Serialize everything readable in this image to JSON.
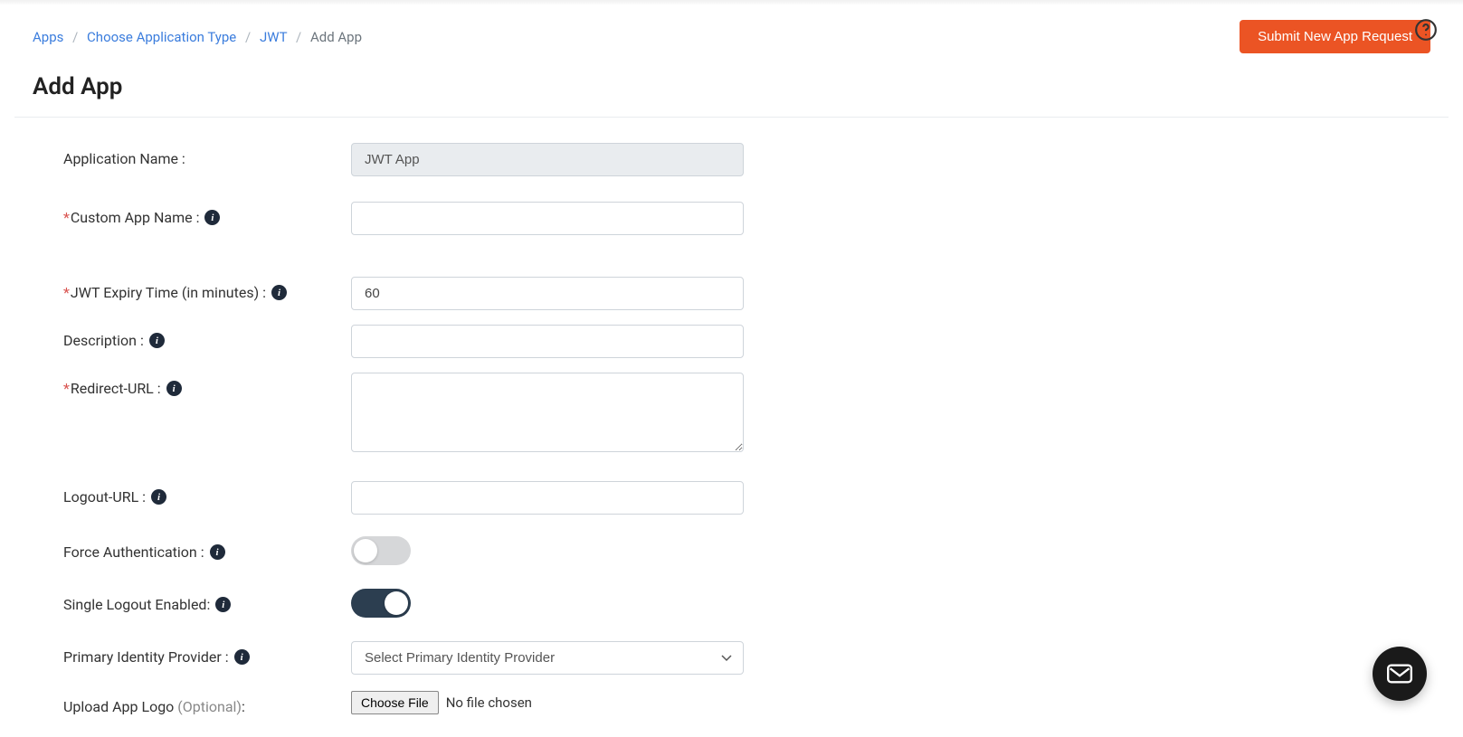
{
  "breadcrumb": {
    "items": [
      "Apps",
      "Choose Application Type",
      "JWT",
      "Add App"
    ]
  },
  "header": {
    "submit_button": "Submit New App Request",
    "page_title": "Add App"
  },
  "form": {
    "application_name": {
      "label": "Application Name :",
      "value": "JWT App"
    },
    "custom_app_name": {
      "label": "Custom App Name :",
      "value": ""
    },
    "jwt_expiry": {
      "label": "JWT Expiry Time (in minutes) :",
      "value": "60"
    },
    "description": {
      "label": "Description :",
      "value": ""
    },
    "redirect_url": {
      "label": "Redirect-URL :",
      "value": ""
    },
    "logout_url": {
      "label": "Logout-URL :",
      "value": ""
    },
    "force_auth": {
      "label": "Force Authentication :",
      "on": false
    },
    "single_logout": {
      "label": "Single Logout Enabled:",
      "on": true
    },
    "primary_idp": {
      "label": "Primary Identity Provider :",
      "placeholder": "Select Primary Identity Provider"
    },
    "upload_logo": {
      "label": "Upload App Logo ",
      "optional": "(Optional)",
      "colon": ":",
      "choose": "Choose File",
      "status": "No file chosen"
    }
  }
}
